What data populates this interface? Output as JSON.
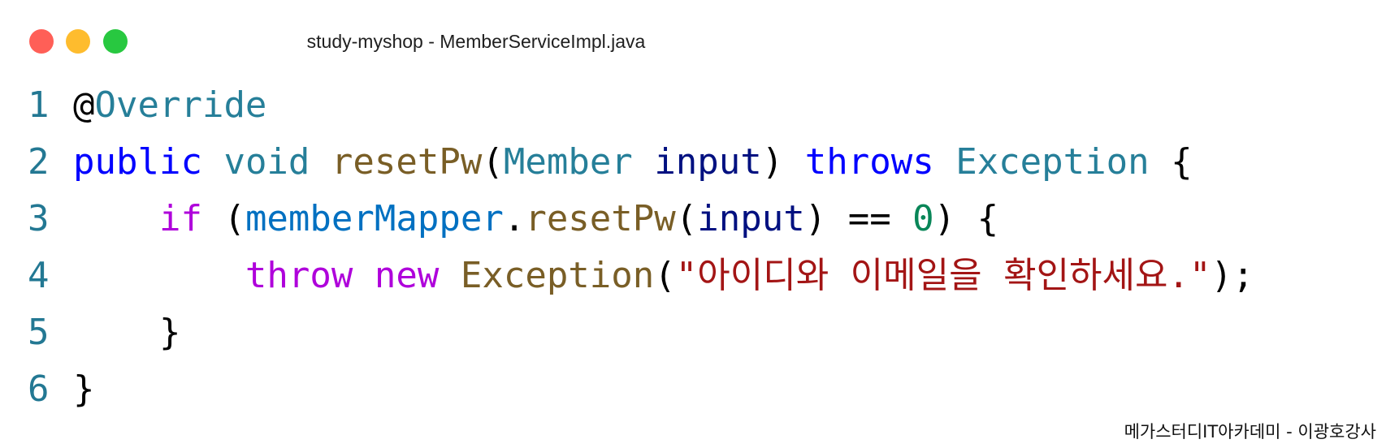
{
  "window": {
    "title": "study-myshop - MemberServiceImpl.java",
    "buttons": [
      {
        "name": "close",
        "color": "#ff5f57"
      },
      {
        "name": "minimize",
        "color": "#febc2e"
      },
      {
        "name": "zoom",
        "color": "#28c840"
      }
    ]
  },
  "code": {
    "lines": [
      {
        "number": "1",
        "tokens": [
          {
            "text": "@",
            "color": "#000000"
          },
          {
            "text": "Override",
            "color": "#267f99"
          }
        ]
      },
      {
        "number": "2",
        "tokens": [
          {
            "text": "public",
            "color": "#0000ff"
          },
          {
            "text": " ",
            "color": "#000000"
          },
          {
            "text": "void",
            "color": "#267f99"
          },
          {
            "text": " ",
            "color": "#000000"
          },
          {
            "text": "resetPw",
            "color": "#795e26"
          },
          {
            "text": "(",
            "color": "#000000"
          },
          {
            "text": "Member",
            "color": "#267f99"
          },
          {
            "text": " ",
            "color": "#000000"
          },
          {
            "text": "input",
            "color": "#001080"
          },
          {
            "text": ") ",
            "color": "#000000"
          },
          {
            "text": "throws",
            "color": "#0000ff"
          },
          {
            "text": " ",
            "color": "#000000"
          },
          {
            "text": "Exception",
            "color": "#267f99"
          },
          {
            "text": " {",
            "color": "#000000"
          }
        ]
      },
      {
        "number": "3",
        "tokens": [
          {
            "text": "    ",
            "color": "#000000"
          },
          {
            "text": "if",
            "color": "#af00db"
          },
          {
            "text": " (",
            "color": "#000000"
          },
          {
            "text": "memberMapper",
            "color": "#0070c1"
          },
          {
            "text": ".",
            "color": "#000000"
          },
          {
            "text": "resetPw",
            "color": "#795e26"
          },
          {
            "text": "(",
            "color": "#000000"
          },
          {
            "text": "input",
            "color": "#001080"
          },
          {
            "text": ") == ",
            "color": "#000000"
          },
          {
            "text": "0",
            "color": "#098658"
          },
          {
            "text": ") {",
            "color": "#000000"
          }
        ]
      },
      {
        "number": "4",
        "tokens": [
          {
            "text": "        ",
            "color": "#000000"
          },
          {
            "text": "throw",
            "color": "#af00db"
          },
          {
            "text": " ",
            "color": "#000000"
          },
          {
            "text": "new",
            "color": "#af00db"
          },
          {
            "text": " ",
            "color": "#000000"
          },
          {
            "text": "Exception",
            "color": "#795e26"
          },
          {
            "text": "(",
            "color": "#000000"
          },
          {
            "text": "\"아이디와 이메일을 확인하세요.\"",
            "color": "#a31515"
          },
          {
            "text": ");",
            "color": "#000000"
          }
        ]
      },
      {
        "number": "5",
        "tokens": [
          {
            "text": "    }",
            "color": "#000000"
          }
        ]
      },
      {
        "number": "6",
        "tokens": [
          {
            "text": "}",
            "color": "#000000"
          }
        ]
      }
    ]
  },
  "watermark": "메가스터디IT아카데미 - 이광호강사"
}
